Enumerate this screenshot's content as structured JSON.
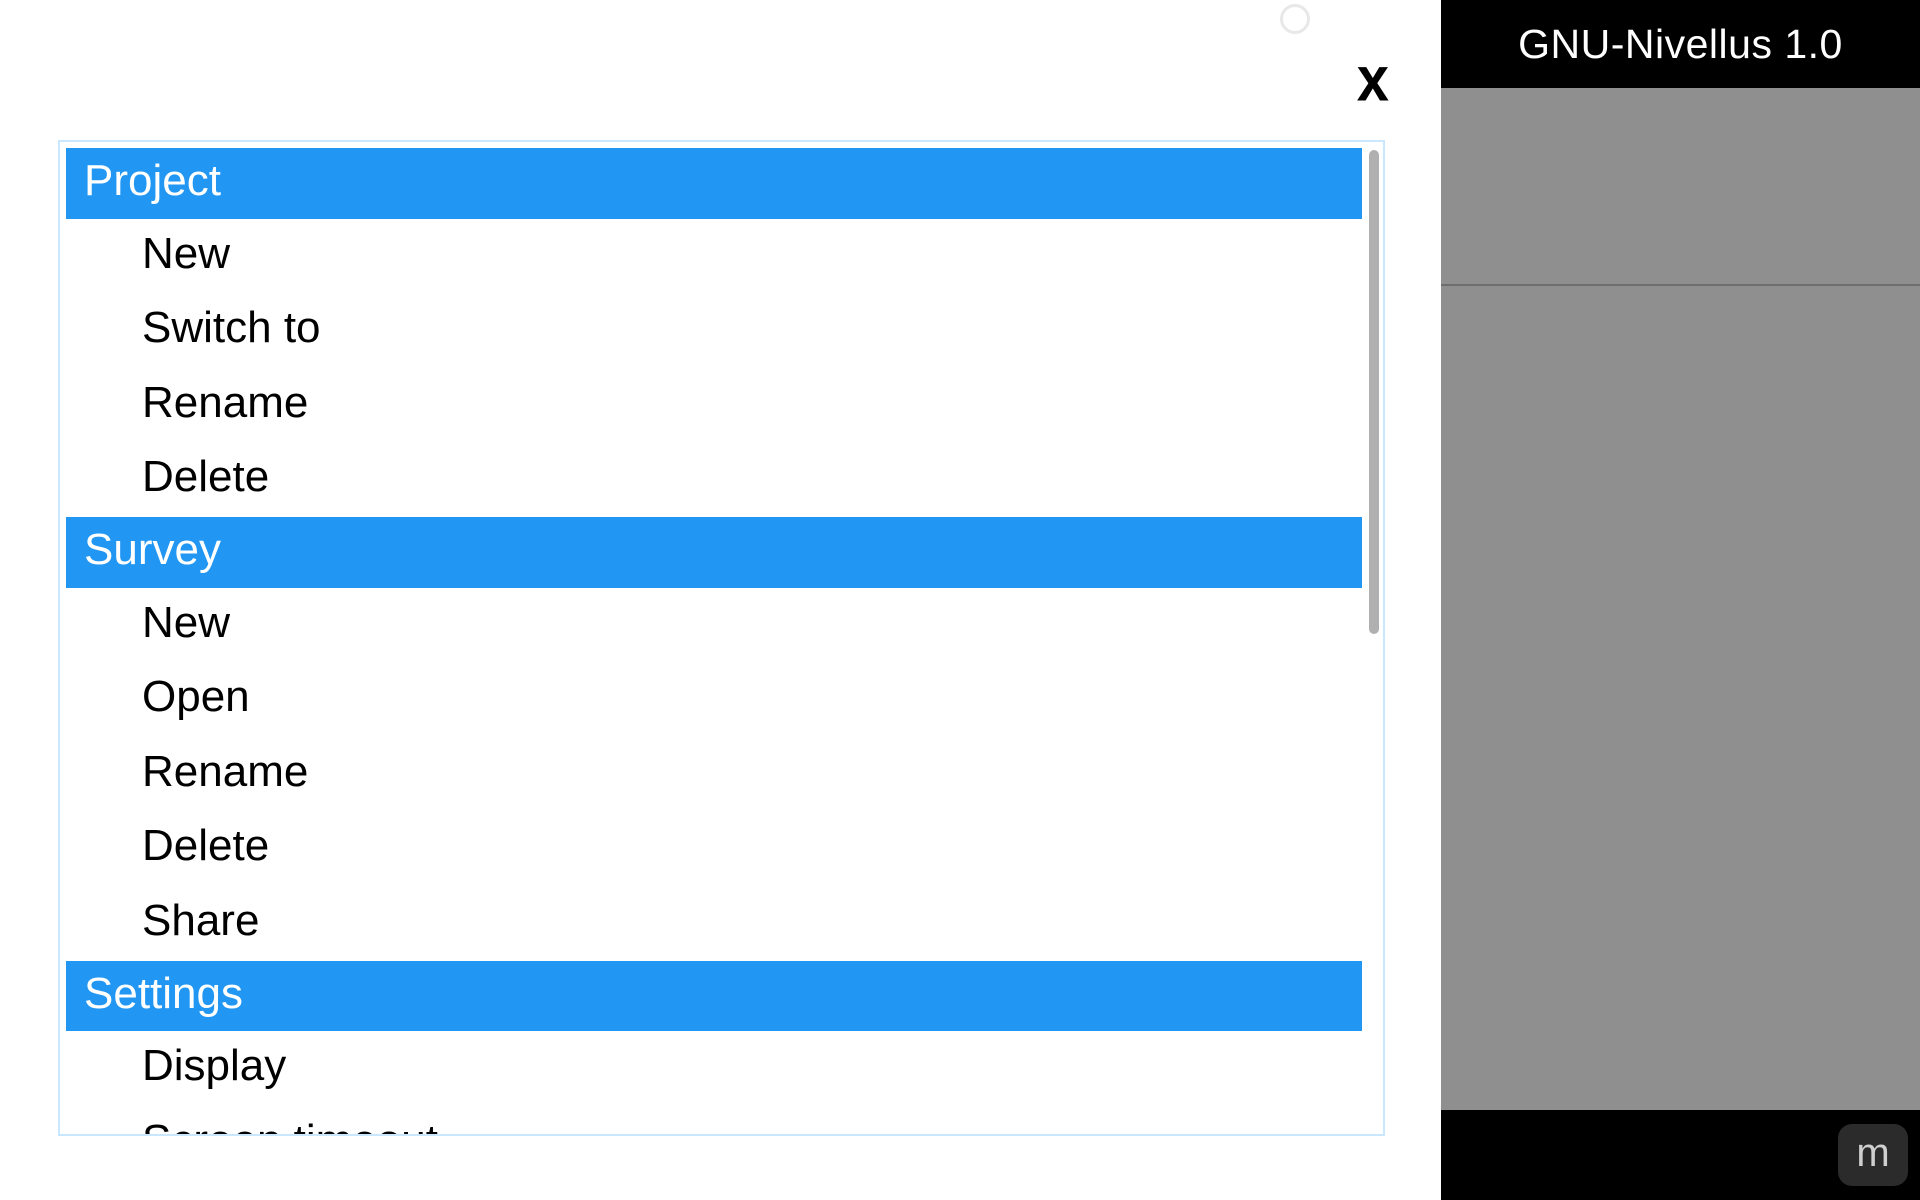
{
  "app": {
    "title": "GNU-Nivellus 1.0",
    "m_badge": "m"
  },
  "modal": {
    "close_label": "x"
  },
  "menu": {
    "sections": [
      {
        "header": "Project",
        "items": [
          "New",
          "Switch to",
          "Rename",
          "Delete"
        ]
      },
      {
        "header": "Survey",
        "items": [
          "New",
          "Open",
          "Rename",
          "Delete",
          "Share"
        ]
      },
      {
        "header": "Settings",
        "items": [
          "Display",
          "Screen timeout"
        ]
      }
    ]
  }
}
